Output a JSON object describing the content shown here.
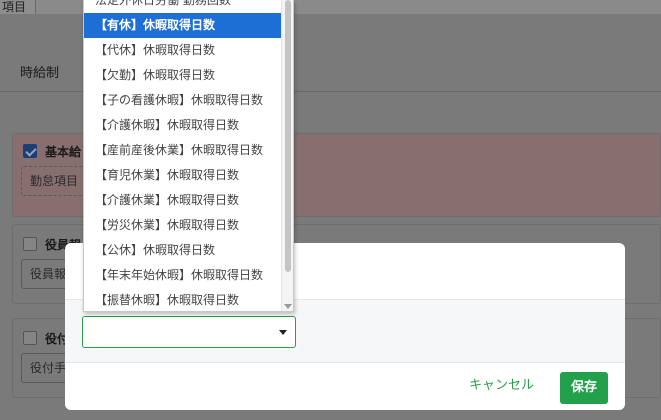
{
  "background": {
    "top_tab": "項目",
    "tab_label": "時給制",
    "panels": [
      {
        "label": "基本給",
        "chip": "勤怠項目",
        "checked": true
      },
      {
        "label": "役員報",
        "chip": "役員報",
        "checked": false
      },
      {
        "label": "役付",
        "chip": "役付手",
        "checked": false
      }
    ]
  },
  "dropdown": {
    "items": [
      "法定外休日労働 勤務回数",
      "【有休】休暇取得日数",
      "【代休】休暇取得日数",
      "【欠勤】休暇取得日数",
      "【子の看護休暇】休暇取得日数",
      "【介護休暇】休暇取得日数",
      "【産前産後休業】休暇取得日数",
      "【育児休業】休暇取得日数",
      "【介護休業】休暇取得日数",
      "【労災休業】休暇取得日数",
      "【公休】休暇取得日数",
      "【年末年始休暇】休暇取得日数",
      "【振替休暇】休暇取得日数"
    ],
    "selected_index": 1,
    "selected_bg": "#1d6fd6"
  },
  "modal": {
    "select_value": "",
    "cancel_label": "キャンセル",
    "save_label": "保存",
    "accent": "#23a04b"
  }
}
